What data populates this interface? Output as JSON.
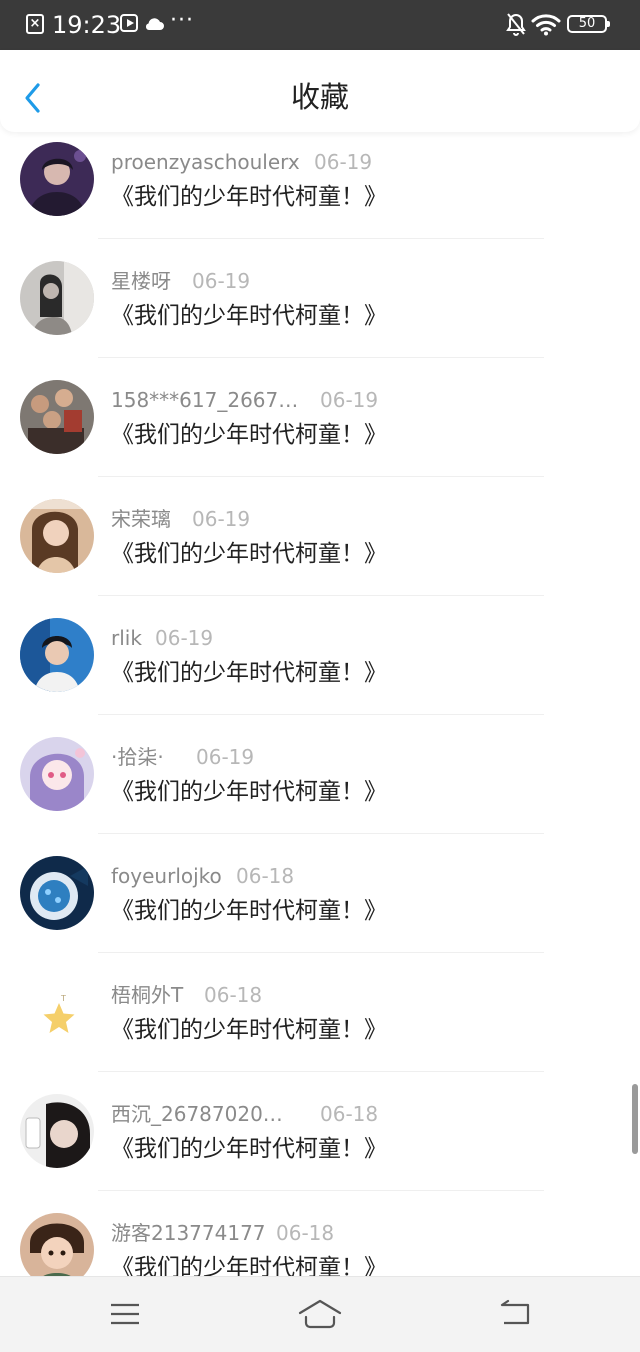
{
  "status_bar": {
    "time": "19:23",
    "dots": "···",
    "battery": "50",
    "icons": [
      "close-icon",
      "play-icon",
      "cloud-icon",
      "bell-off-icon",
      "wifi-icon",
      "battery-icon"
    ]
  },
  "header": {
    "title": "收藏",
    "back_icon": "chevron-left-icon",
    "accent": "#1e9be8"
  },
  "items": [
    {
      "name": "proenzyaschoulerx",
      "date": "06-19",
      "title": "《我们的少年时代柯童！》",
      "avatar": "avatar-purple-portrait"
    },
    {
      "name": "星楼呀",
      "date": "06-19",
      "title": "《我们的少年时代柯童！》",
      "avatar": "avatar-bw-girl"
    },
    {
      "name": "158***617_2667…",
      "date": "06-19",
      "title": "《我们的少年时代柯童！》",
      "avatar": "avatar-group-photo"
    },
    {
      "name": "宋荣璃",
      "date": "06-19",
      "title": "《我们的少年时代柯童！》",
      "avatar": "avatar-girl-selfie"
    },
    {
      "name": "rlik",
      "date": "06-19",
      "title": "《我们的少年时代柯童！》",
      "avatar": "avatar-boy-blue"
    },
    {
      "name": "·拾柒·",
      "date": "06-19",
      "title": "《我们的少年时代柯童！》",
      "avatar": "avatar-anime-girl"
    },
    {
      "name": "foyeurlojko",
      "date": "06-18",
      "title": "《我们的少年时代柯童！》",
      "avatar": "avatar-dark-blue-art"
    },
    {
      "name": "梧桐外T",
      "date": "06-18",
      "title": "《我们的少年时代柯童！》",
      "avatar": "avatar-star"
    },
    {
      "name": "西沉_26787020…",
      "date": "06-18",
      "title": "《我们的少年时代柯童！》",
      "avatar": "avatar-dark-hair"
    },
    {
      "name": "游客213774177",
      "date": "06-18",
      "title": "《我们的少年时代柯童！》",
      "avatar": "avatar-child"
    }
  ],
  "nav": {
    "icons": [
      "menu-icon",
      "home-icon",
      "back-icon"
    ]
  }
}
